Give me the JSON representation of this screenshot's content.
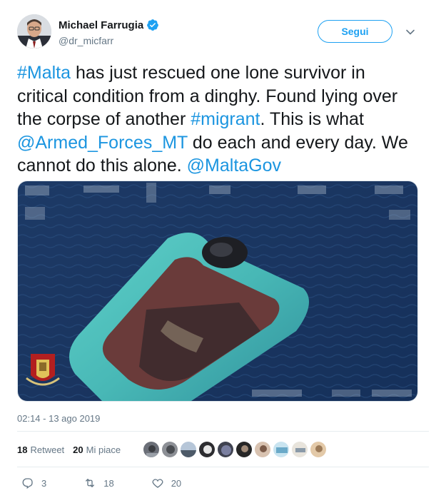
{
  "author": {
    "name": "Michael Farrugia",
    "handle": "@dr_micfarr",
    "verified": true
  },
  "follow_button": "Segui",
  "tweet": {
    "parts": [
      {
        "text": "#Malta",
        "link": true
      },
      {
        "text": " has just rescued one lone survivor in critical condition from a dinghy. Found lying over the corpse of another ",
        "link": false
      },
      {
        "text": "#migrant",
        "link": true
      },
      {
        "text": ". This is what ",
        "link": false
      },
      {
        "text": "@Armed_Forces_MT",
        "link": true
      },
      {
        "text": " do each and every day. We cannot do this alone. ",
        "link": false
      },
      {
        "text": "@MaltaGov",
        "link": true
      }
    ]
  },
  "timestamp": "02:14 - 13 ago 2019",
  "stats": {
    "retweets_count": "18",
    "retweets_label": "Retweet",
    "likes_count": "20",
    "likes_label": "Mi piace"
  },
  "actions": {
    "reply_count": "3",
    "retweet_count": "18",
    "like_count": "20"
  },
  "colors": {
    "link": "#1b95e0",
    "accent": "#1da1f2",
    "secondary_text": "#657786"
  },
  "icons": [
    "verified-icon",
    "caret-down-icon",
    "reply-icon",
    "retweet-icon",
    "like-icon"
  ]
}
